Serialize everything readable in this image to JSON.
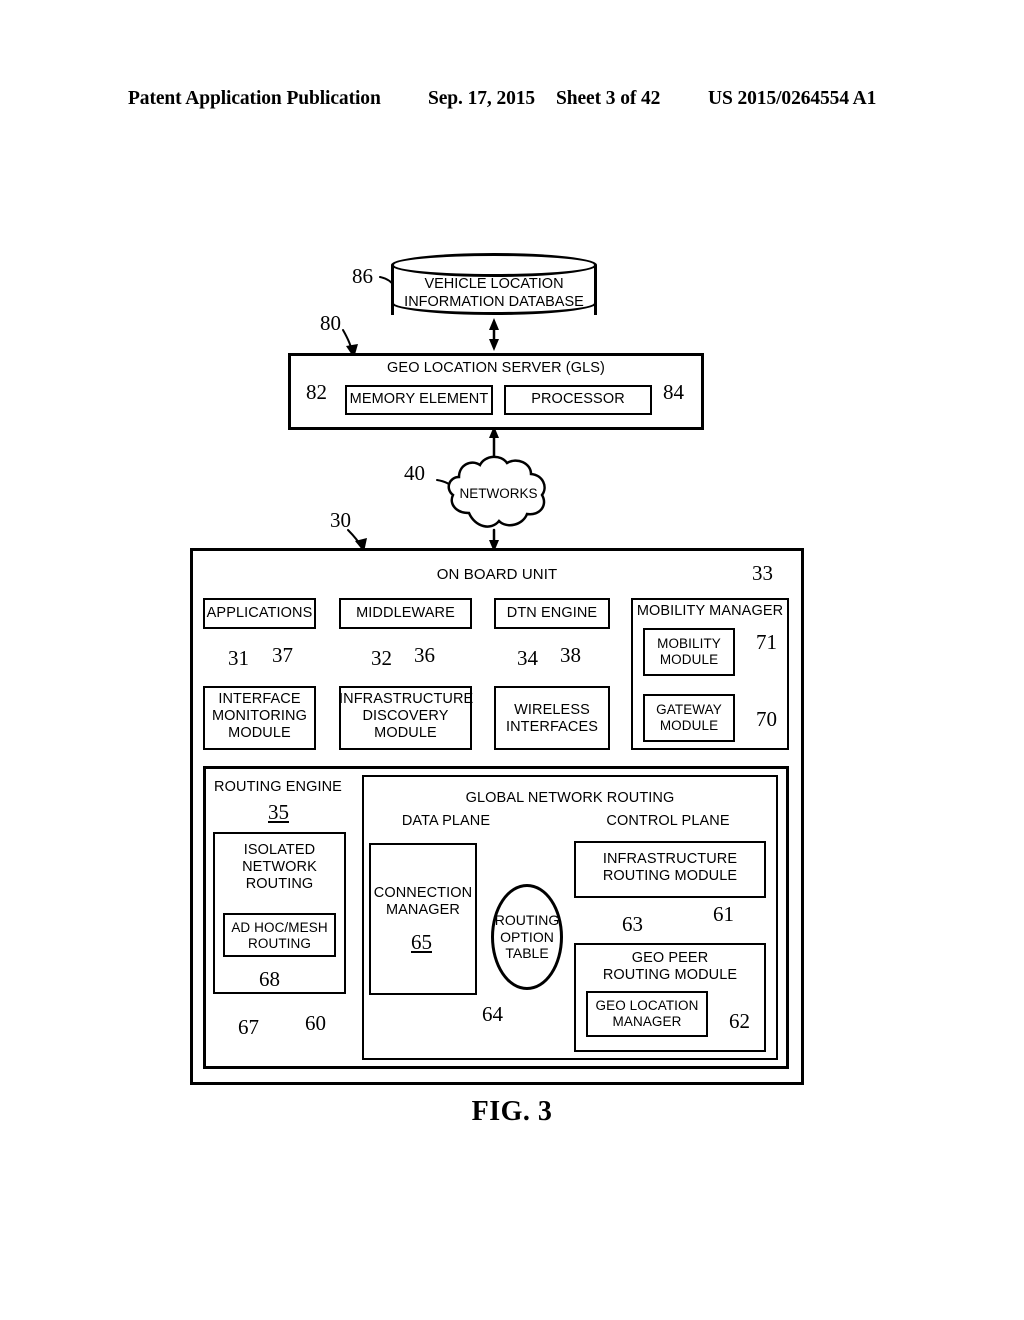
{
  "header": {
    "title": "Patent Application Publication",
    "date": "Sep. 17, 2015",
    "sheet": "Sheet 3 of 42",
    "number": "US 2015/0264554 A1"
  },
  "figure": {
    "caption": "FIG. 3"
  },
  "nodes": {
    "database": {
      "label": "VEHICLE LOCATION\nINFORMATION DATABASE",
      "ref": "86"
    },
    "gls": {
      "title": "GEO LOCATION SERVER (GLS)",
      "ref": "80",
      "memory_element": {
        "label": "MEMORY ELEMENT",
        "ref": "82"
      },
      "processor": {
        "label": "PROCESSOR",
        "ref": "84"
      }
    },
    "networks": {
      "label": "NETWORKS",
      "ref": "40"
    },
    "obu": {
      "title": "ON BOARD UNIT",
      "ref": "30",
      "applications": {
        "label": "APPLICATIONS",
        "ref": "31"
      },
      "interface_monitoring": {
        "label": "INTERFACE\nMONITORING\nMODULE",
        "ref": "37"
      },
      "middleware": {
        "label": "MIDDLEWARE",
        "ref": "32"
      },
      "infrastructure_discovery": {
        "label": "INFRASTRUCTURE\nDISCOVERY\nMODULE",
        "ref": "36"
      },
      "dtn_engine": {
        "label": "DTN ENGINE",
        "ref": "34"
      },
      "wireless_interfaces": {
        "label": "WIRELESS\nINTERFACES",
        "ref": "38"
      },
      "mobility_manager": {
        "label": "MOBILITY MANAGER",
        "ref": "33",
        "mobility_module": {
          "label": "MOBILITY\nMODULE",
          "ref": "71"
        },
        "gateway_module": {
          "label": "GATEWAY\nMODULE",
          "ref": "70"
        }
      }
    },
    "routing_engine": {
      "title": "ROUTING ENGINE",
      "ref": "35",
      "isolated_network_routing": {
        "label": "ISOLATED\nNETWORK\nROUTING",
        "ref": "67"
      },
      "ad_hoc_mesh_routing": {
        "label": "AD HOC/MESH\nROUTING",
        "ref": "68"
      },
      "global_network_routing": {
        "title": "GLOBAL NETWORK ROUTING",
        "ref": "60"
      },
      "data_plane": {
        "title": "DATA PLANE"
      },
      "connection_manager": {
        "label": "CONNECTION\nMANAGER",
        "ref": "65"
      },
      "routing_option_table": {
        "label": "ROUTING\nOPTION\nTABLE",
        "ref": "64"
      },
      "control_plane": {
        "title": "CONTROL PLANE"
      },
      "infrastructure_routing_module": {
        "label": "INFRASTRUCTURE\nROUTING MODULE",
        "ref": "63"
      },
      "geo_peer_routing_module": {
        "label": "GEO PEER\nROUTING MODULE",
        "ref": "61"
      },
      "geo_location_manager": {
        "label": "GEO LOCATION\nMANAGER",
        "ref": "62"
      }
    }
  },
  "colors": {
    "ink": "#000000",
    "paper": "#ffffff"
  }
}
